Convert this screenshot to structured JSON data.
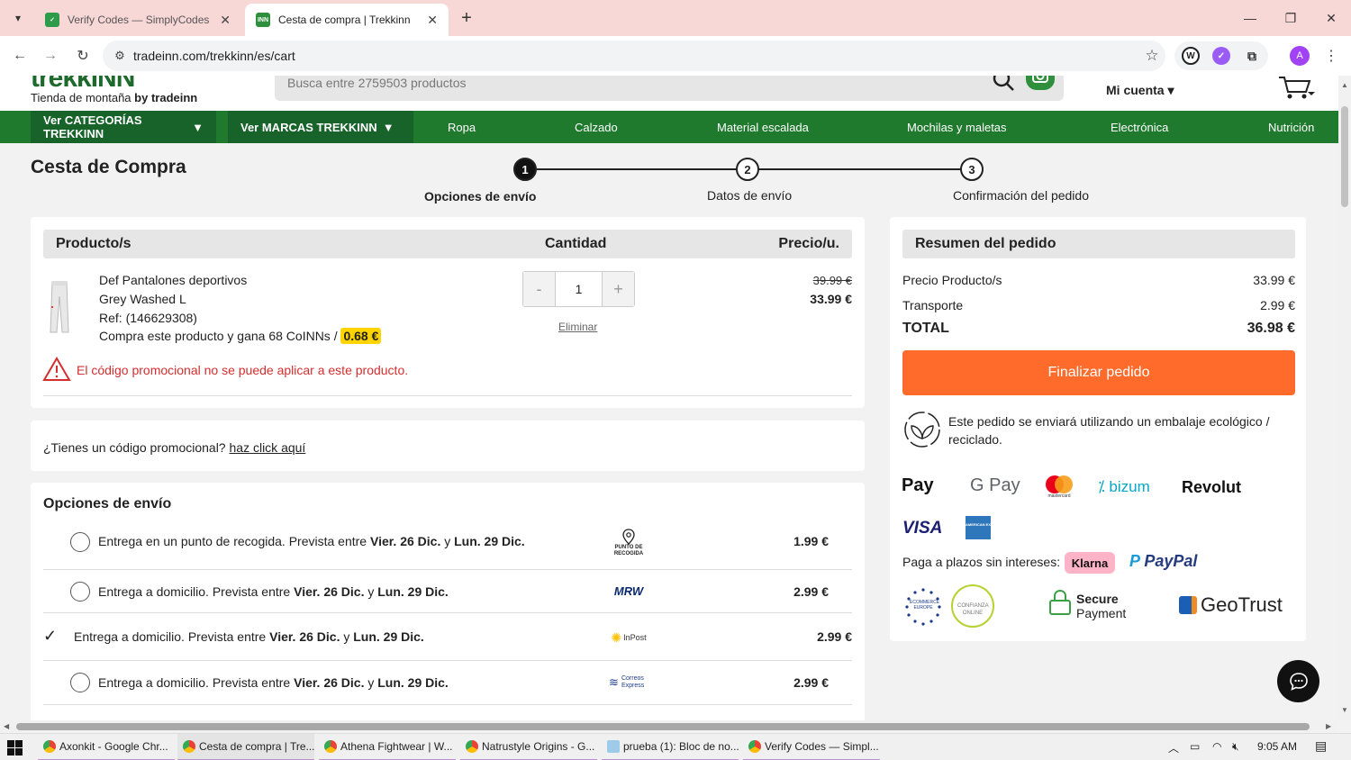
{
  "browser": {
    "tabs": [
      {
        "title": "Verify Codes — SimplyCodes",
        "active": false
      },
      {
        "title": "Cesta de compra | Trekkinn",
        "active": true
      }
    ],
    "url": "tradeinn.com/trekkinn/es/cart",
    "profile_initial": "A"
  },
  "header": {
    "logo": "trekkINN",
    "tagline_prefix": "Tienda de montaña",
    "tagline_brand": "by tradeinn",
    "search_placeholder": "Busca entre 2759503 productos",
    "account_label": "Mi cuenta"
  },
  "catnav": {
    "categories_label": "Ver CATEGORÍAS TREKKINN",
    "brands_label": "Ver MARCAS TREKKINN",
    "links": [
      "Ropa",
      "Calzado",
      "Material escalada",
      "Mochilas y maletas",
      "Electrónica",
      "Nutrición"
    ]
  },
  "checkout": {
    "title": "Cesta de Compra",
    "steps": [
      {
        "num": "1",
        "label": "Opciones de envío"
      },
      {
        "num": "2",
        "label": "Datos de envío"
      },
      {
        "num": "3",
        "label": "Confirmación del pedido"
      }
    ]
  },
  "cart": {
    "col_product": "Producto/s",
    "col_qty": "Cantidad",
    "col_price": "Precio/u.",
    "item": {
      "name": "Def Pantalones deportivos",
      "variant": "Grey Washed L",
      "ref": "Ref: (146629308)",
      "coins_text": "Compra este producto y gana 68 CoINNs /",
      "coins_value": "0.68 €",
      "qty": "1",
      "qty_minus": "-",
      "qty_plus": "+",
      "remove_label": "Eliminar",
      "old_price": "39.99 €",
      "price": "33.99 €"
    },
    "promo_warning": "El código promocional no se puede aplicar a este producto."
  },
  "promo": {
    "question": "¿Tienes un código promocional?",
    "link": "haz click aquí"
  },
  "shipping": {
    "title": "Opciones de envío",
    "options": [
      {
        "desc_prefix": "Entrega en un punto de recogida. Prevista entre",
        "date_from": "Vier. 26 Dic.",
        "conj": "y",
        "date_to": "Lun. 29 Dic.",
        "carrier": "PUNTO DE RECOGIDA",
        "price": "1.99 €",
        "selected": false
      },
      {
        "desc_prefix": "Entrega a domicilio. Prevista entre",
        "date_from": "Vier. 26 Dic.",
        "conj": "y",
        "date_to": "Lun. 29 Dic.",
        "carrier": "MRW",
        "price": "2.99 €",
        "selected": false
      },
      {
        "desc_prefix": "Entrega a domicilio. Prevista entre",
        "date_from": "Vier. 26 Dic.",
        "conj": "y",
        "date_to": "Lun. 29 Dic.",
        "carrier": "InPost",
        "price": "2.99 €",
        "selected": true
      },
      {
        "desc_prefix": "Entrega a domicilio. Prevista entre",
        "date_from": "Vier. 26 Dic.",
        "conj": "y",
        "date_to": "Lun. 29 Dic.",
        "carrier": "Correos Express",
        "price": "2.99 €",
        "selected": false
      }
    ]
  },
  "summary": {
    "title": "Resumen del pedido",
    "products_label": "Precio Producto/s",
    "products_value": "33.99 €",
    "transport_label": "Transporte",
    "transport_value": "2.99 €",
    "total_label": "TOTAL",
    "total_value": "36.98 €",
    "checkout_button": "Finalizar pedido",
    "eco_text": "Este pedido se enviará utilizando un embalaje ecológico / reciclado.",
    "payment_methods": [
      "Pay",
      "G Pay",
      "mastercard",
      "bizum",
      "Revolut",
      "VISA",
      "AMERICAN EXPRESS"
    ],
    "installments_label": "Paga a plazos sin intereses:",
    "klarna": "Klarna",
    "paypal": "PayPal",
    "trust": {
      "ecommerce": "ECOMMERCE EUROPE",
      "confianza": "CONFIANZA ONLINE",
      "secure_line1": "Secure",
      "secure_line2": "Payment",
      "geotrust": "GeoTrust"
    }
  },
  "taskbar": {
    "items": [
      "Axonkit - Google Chr...",
      "Cesta de compra | Tre...",
      "Athena Fightwear | W...",
      "Natrustyle Origins - G...",
      "prueba (1): Bloc de no...",
      "Verify Codes — Simpl..."
    ],
    "time": "9:05 AM"
  },
  "colors": {
    "brand_green": "#1f7a2e",
    "checkout_orange": "#ff6b2b",
    "warning_red": "#d32f2f",
    "coin_yellow": "#ffd400"
  }
}
